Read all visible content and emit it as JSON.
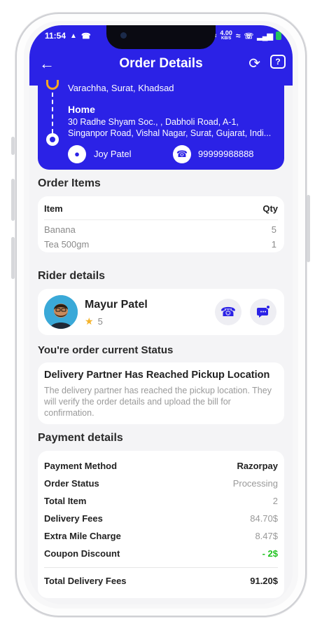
{
  "status_bar": {
    "time": "11:54",
    "network_speed": "4.00",
    "speed_unit": "KB/S"
  },
  "header": {
    "title": "Order Details"
  },
  "address": {
    "pickup_line": "Varachha, Surat, Khadsad",
    "drop_label": "Home",
    "drop_line1": "30 Radhe Shyam Soc., , Dabholi Road, A-1,",
    "drop_line2": "Singanpor Road, Vishal Nagar, Surat, Gujarat, Indi...",
    "contact_name": "Joy Patel",
    "contact_phone": "99999988888"
  },
  "order_items": {
    "title": "Order Items",
    "col_item": "Item",
    "col_qty": "Qty",
    "rows": [
      {
        "name": "Banana",
        "qty": "5"
      },
      {
        "name": "Tea 500gm",
        "qty": "1"
      }
    ]
  },
  "rider": {
    "title": "Rider details",
    "name": "Mayur Patel",
    "rating": "5"
  },
  "order_status": {
    "title": "You're order current Status",
    "heading": "Delivery Partner Has Reached Pickup Location",
    "description": "The delivery partner has reached the pickup location. They will verify the order details and upload the bill for confirmation."
  },
  "payment": {
    "title": "Payment details",
    "rows": [
      {
        "label": "Payment Method",
        "value": "Razorpay"
      },
      {
        "label": "Order Status",
        "value": "Processing"
      },
      {
        "label": "Total Item",
        "value": "2"
      },
      {
        "label": "Delivery Fees",
        "value": "84.70$"
      },
      {
        "label": "Extra Mile Charge",
        "value": "8.47$"
      },
      {
        "label": "Coupon Discount",
        "value": "- 2$"
      }
    ],
    "total_label": "Total Delivery Fees",
    "total_value": "91.20$"
  },
  "colors": {
    "primary": "#2b22e6",
    "accent_orange": "#f5a623",
    "discount_green": "#1ec31e",
    "star": "#f5b32a"
  }
}
